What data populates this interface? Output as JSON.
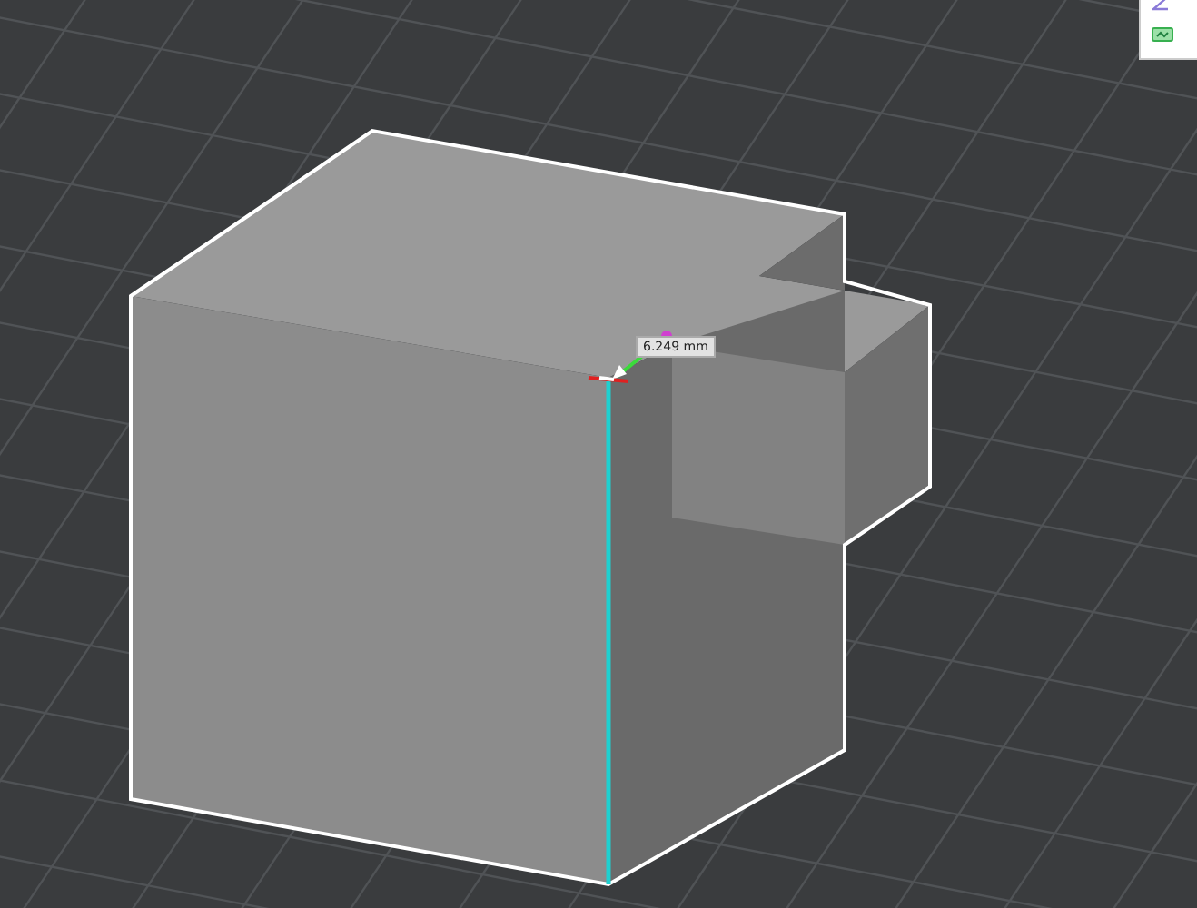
{
  "viewport": {
    "measurement": {
      "reading": "6.249 mm"
    }
  }
}
